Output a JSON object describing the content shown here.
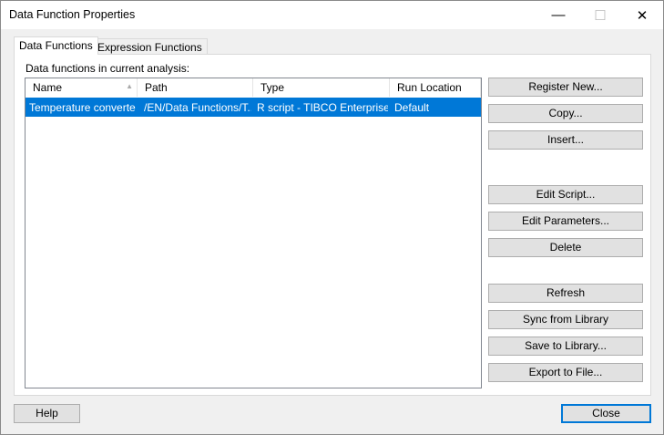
{
  "window": {
    "title": "Data Function Properties",
    "minimize": "—",
    "maximize": "☐",
    "close": "✕"
  },
  "tabs": [
    {
      "label": "Data Functions",
      "selected": true
    },
    {
      "label": "Expression Functions",
      "selected": false
    }
  ],
  "list_label": "Data functions in current analysis:",
  "columns": [
    "Name",
    "Path",
    "Type",
    "Run Location"
  ],
  "sort_indicator": "▲",
  "rows": [
    {
      "name": "Temperature converter",
      "path": "/EN/Data Functions/T...",
      "type": "R script - TIBCO Enterprise ...",
      "run_location": "Default",
      "selected": true
    }
  ],
  "buttons": [
    "Register New...",
    "Copy...",
    "Insert...",
    "Edit Script...",
    "Edit Parameters...",
    "Delete",
    "Refresh",
    "Sync from Library",
    "Save to Library...",
    "Export to File..."
  ],
  "footer": {
    "help": "Help",
    "close": "Close"
  },
  "colors": {
    "selection": "#0078d7",
    "accent_border": "#0078d7"
  }
}
